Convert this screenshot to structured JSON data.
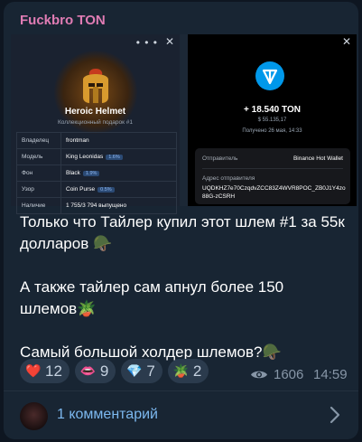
{
  "channel": {
    "name": "Fuckbro TON",
    "accent_color": "#e07cb4"
  },
  "media": {
    "left": {
      "title": "Heroic Helmet",
      "subtitle": "Коллекционный подарок #1",
      "attributes": [
        {
          "key": "Владелец",
          "value": "frontman",
          "tag": ""
        },
        {
          "key": "Модель",
          "value": "King Leonidas",
          "tag": "1.6%"
        },
        {
          "key": "Фон",
          "value": "Black",
          "tag": "1.9%"
        },
        {
          "key": "Узор",
          "value": "Coin Purse",
          "tag": "0.5%"
        },
        {
          "key": "Наличие",
          "value": "1 755/3 794 выпущено",
          "tag": ""
        }
      ]
    },
    "right": {
      "amount": "+ 18.540 TON",
      "usd": "$ 55.135,17",
      "date": "Получено 26 мая, 14:33",
      "sender_label": "Отправитель",
      "sender_name": "Binance Hot Wallet",
      "address_label": "Адрес отправителя",
      "address": "UQDKHZ7e70CzqdvZCC83Z4WVR8POC_ZB0J1Y4zo88G-zCSRH"
    }
  },
  "message": "Только что Тайлер купил этот шлем #1 за 55к долларов 🪖\n\nА также тайлер сам апнул более 150 шлемов🪴\n\nСамый большой холдер шлемов?🪖",
  "reactions": [
    {
      "icon": "heart-icon",
      "emoji": "❤️",
      "count": "12"
    },
    {
      "icon": "lips-icon",
      "emoji": "👄",
      "count": "9"
    },
    {
      "icon": "diamond-icon",
      "emoji": "💎",
      "count": "7"
    },
    {
      "icon": "plant-icon",
      "emoji": "🪴",
      "count": "2"
    }
  ],
  "views": "1606",
  "time": "14:59",
  "comments_label": "1 комментарий"
}
